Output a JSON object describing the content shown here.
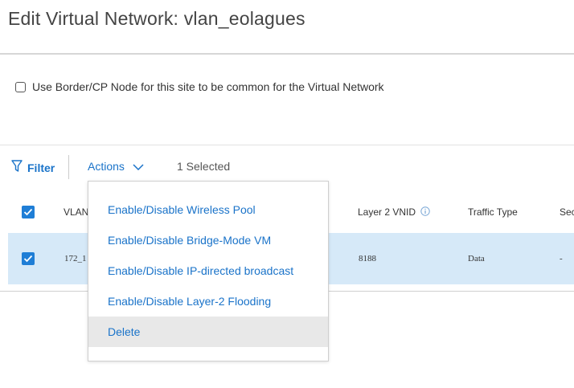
{
  "page": {
    "title": "Edit Virtual Network: vlan_eolagues"
  },
  "border_option": {
    "label": "Use Border/CP Node for this site to be common for the Virtual Network",
    "checked": false
  },
  "toolbar": {
    "filter_label": "Filter",
    "actions_label": "Actions",
    "selected_text": "1 Selected"
  },
  "table": {
    "headers": {
      "vlan": "VLAN",
      "layer2_vnid": "Layer 2 VNID",
      "traffic_type": "Traffic Type",
      "security": "Sec"
    },
    "rows": [
      {
        "vlan": "172_1",
        "layer2_vnid": "8188",
        "traffic_type": "Data",
        "security": "-",
        "selected": true
      }
    ]
  },
  "actions_menu": {
    "items": [
      {
        "label": "Enable/Disable Wireless Pool"
      },
      {
        "label": "Enable/Disable Bridge-Mode VM"
      },
      {
        "label": "Enable/Disable IP-directed broadcast"
      },
      {
        "label": "Enable/Disable Layer-2 Flooding"
      },
      {
        "label": "Delete",
        "highlighted": true
      }
    ]
  },
  "colors": {
    "accent": "#1a73c9",
    "checkbox": "#1f7ed6",
    "selected_row": "#d6e9f8",
    "menu_hover": "#e8e8e8"
  }
}
